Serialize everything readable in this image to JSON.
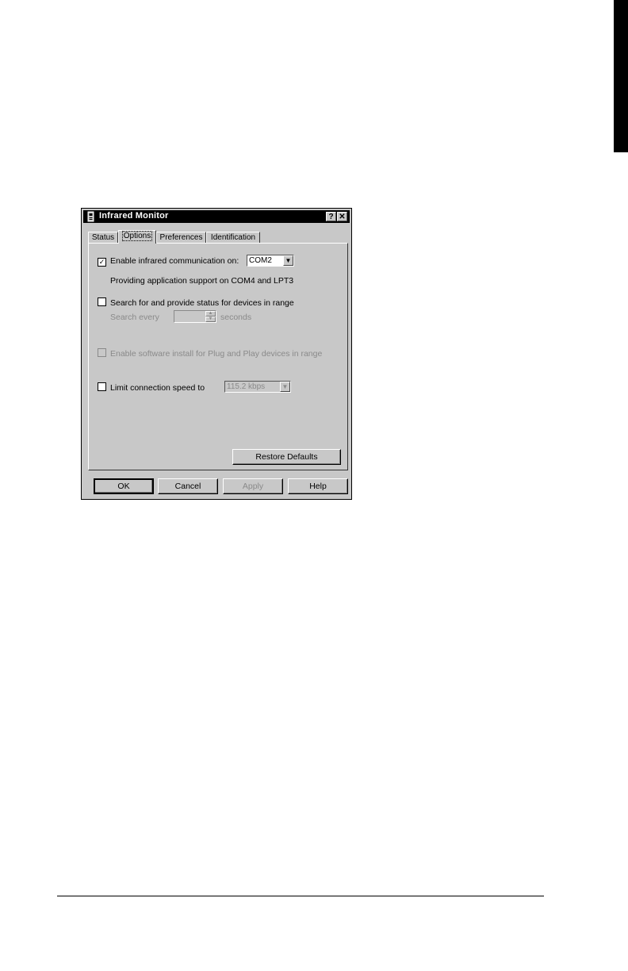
{
  "window": {
    "title": "Infrared Monitor",
    "help_button": "?",
    "close_button": "✕"
  },
  "tabs": [
    {
      "label": "Status",
      "active": false
    },
    {
      "label": "Options",
      "active": true
    },
    {
      "label": "Preferences",
      "active": false
    },
    {
      "label": "Identification",
      "active": false
    }
  ],
  "options": {
    "enable_ir": {
      "label": "Enable infrared communication on:",
      "checked": true,
      "port": "COM2"
    },
    "support_text": "Providing application support on COM4 and LPT3",
    "search": {
      "label": "Search for and provide status for devices in range",
      "checked": false
    },
    "search_every": {
      "label": "Search every",
      "value": "",
      "unit": "seconds"
    },
    "pnp": {
      "label": "Enable software install for Plug and Play devices in range",
      "checked": false
    },
    "limit_speed": {
      "label": "Limit connection speed to",
      "checked": false,
      "speed": "115.2 kbps"
    },
    "restore_defaults": "Restore Defaults"
  },
  "buttons": {
    "ok": "OK",
    "cancel": "Cancel",
    "apply": "Apply",
    "help": "Help"
  },
  "glyphs": {
    "check_mark": "✓",
    "dropdown_arrow": "▼",
    "spin_up": "▲",
    "spin_down": "▼"
  },
  "colors": {
    "dialog_face": "#c8c8c8",
    "titlebar": "#000000",
    "disabled_text": "#8a8a8a"
  }
}
